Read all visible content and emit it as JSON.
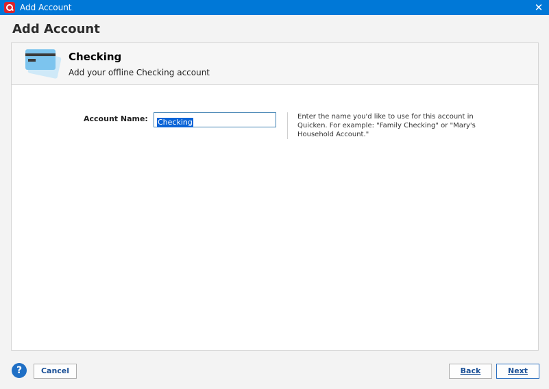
{
  "window": {
    "title": "Add Account",
    "close_glyph": "✕"
  },
  "page": {
    "heading": "Add Account"
  },
  "account_type": {
    "title": "Checking",
    "description": "Add your offline Checking account",
    "icon": "credit-card-icon",
    "icon_color": "#7cc4ee"
  },
  "form": {
    "account_name_label": "Account Name:",
    "account_name_value": "Checking",
    "help_text": "Enter the name you'd like to use for this account in Quicken. For example: \"Family Checking\" or \"Mary's Household Account.\""
  },
  "footer": {
    "help_glyph": "?",
    "cancel_label": "Cancel",
    "back_label": "Back",
    "next_label": "Next"
  },
  "colors": {
    "titlebar": "#0078d7",
    "app_icon": "#d9242d",
    "selection": "#0a64d7",
    "help_button": "#1f6fc5"
  }
}
